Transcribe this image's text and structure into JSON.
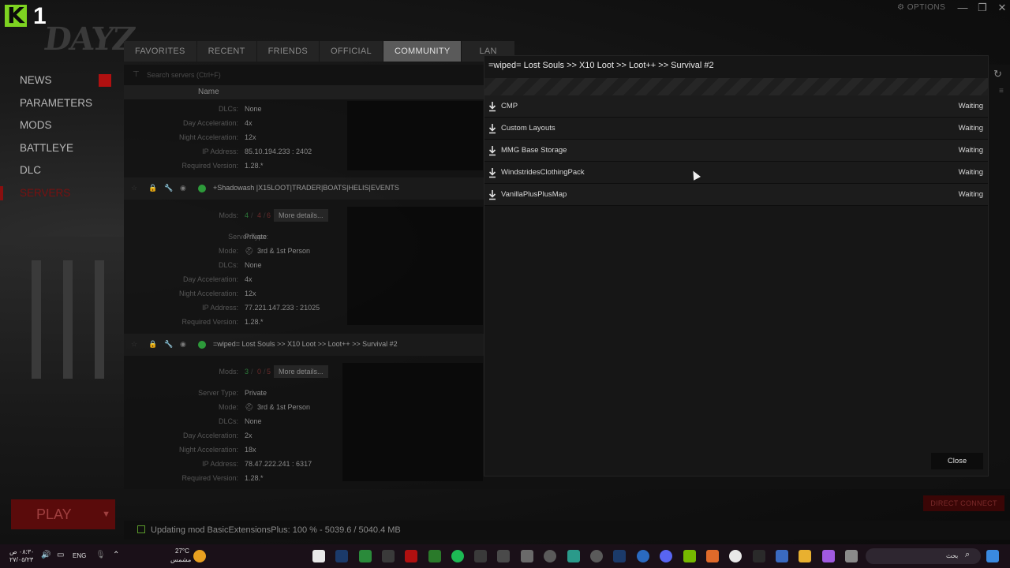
{
  "logo": {
    "letter": "K",
    "number": "1",
    "game": "DAYZ"
  },
  "options_label": "OPTIONS",
  "nav": {
    "items": [
      {
        "label": "NEWS"
      },
      {
        "label": "PARAMETERS"
      },
      {
        "label": "MODS"
      },
      {
        "label": "BATTLEYE"
      },
      {
        "label": "DLC"
      },
      {
        "label": "SERVERS"
      }
    ],
    "play_label": "PLAY"
  },
  "tabs": [
    "FAVORITES",
    "RECENT",
    "FRIENDS",
    "OFFICIAL",
    "COMMUNITY",
    "LAN"
  ],
  "search": {
    "placeholder": "Search servers (Ctrl+F)"
  },
  "list_header": {
    "name": "Name"
  },
  "server_top": {
    "dlcs": "None",
    "day_acc": "4x",
    "night_acc": "12x",
    "ip": "85.10.194.233 : 2402",
    "version": "1.28.*"
  },
  "labels": {
    "dlcs": "DLCs:",
    "day_acc": "Day Acceleration:",
    "night_acc": "Night Acceleration:",
    "ip": "IP Address:",
    "version": "Required Version:",
    "mods": "Mods:",
    "server_type": "Server Type:",
    "mode": "Mode:",
    "more_details": "More details..."
  },
  "server_a": {
    "name": "+Shadowash |X15LOOT|TRADER|BOATS|HELIS|EVENTS",
    "mods_a": "4",
    "mods_b": "4",
    "mods_c": "6",
    "type": "Private",
    "mode": "3rd & 1st Person",
    "dlcs": "None",
    "day_acc": "4x",
    "night_acc": "12x",
    "ip": "77.221.147.233 : 21025",
    "version": "1.28.*"
  },
  "server_b": {
    "name": "=wiped= Lost Souls >> X10 Loot >> Loot++ >> Survival #2",
    "mods_a": "3",
    "mods_b": "0",
    "mods_c": "5",
    "type": "Private",
    "mode": "3rd & 1st Person",
    "dlcs": "None",
    "day_acc": "2x",
    "night_acc": "18x",
    "ip": "78.47.222.241 : 6317",
    "version": "1.28.*"
  },
  "modal": {
    "title": "=wiped= Lost Souls >> X10 Loot >> Loot++ >> Survival #2",
    "progress": 0,
    "mods": [
      {
        "name": "CMP",
        "status": "Waiting"
      },
      {
        "name": "Custom Layouts",
        "status": "Waiting"
      },
      {
        "name": "MMG Base Storage",
        "status": "Waiting"
      },
      {
        "name": "WindstridesClothingPack",
        "status": "Waiting"
      },
      {
        "name": "VanillaPlusPlusMap",
        "status": "Waiting"
      }
    ],
    "close_label": "Close"
  },
  "direct_connect": "DIRECT CONNECT",
  "status_bar": {
    "text": "Updating mod BasicExtensionsPlus: 100 % - 5039.6 / 5040.4 MB"
  },
  "taskbar": {
    "time": "٠٨:٣٠ ص",
    "date": "٢٧/٠٥/٢٣",
    "lang": "ENG",
    "weather_temp": "27°C",
    "weather_desc": "مشمس",
    "search_placeholder": "بحث"
  },
  "colors": {
    "accent_red": "#8a0f0f",
    "online_green": "#2d9a3a",
    "logo_green": "#7ed321"
  }
}
